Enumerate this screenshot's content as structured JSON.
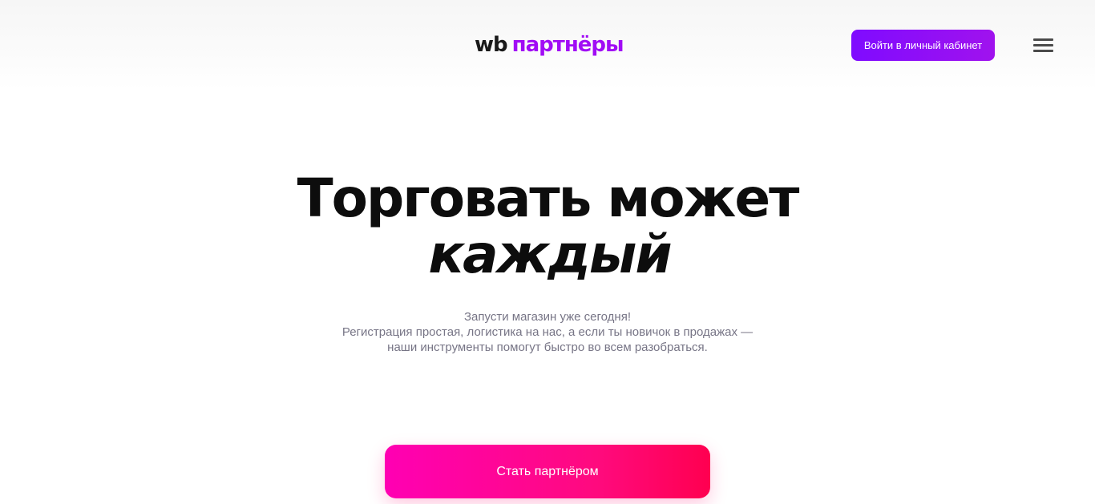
{
  "header": {
    "logo": {
      "wb": "wb",
      "partners": "партнёры"
    },
    "login_button_label": "Войти в личный кабинет",
    "menu_icon": "hamburger-menu-icon"
  },
  "hero": {
    "title_line1": "Торговать может",
    "title_line2": "каждый",
    "subtitle_lines": [
      "Запусти магазин уже сегодня!",
      "Регистрация простая, логистика на нас, а если ты новичок в продажах —",
      "наши инструменты помогут быстро во всем разобраться."
    ],
    "cta_label": "Стать партнёром"
  },
  "colors": {
    "brand_purple": "#a10cf5",
    "login_button": "#8a0dfb",
    "cta_pink": "#ff0a7e",
    "title_text": "#0d0d0d",
    "subtitle_text": "#777586"
  }
}
